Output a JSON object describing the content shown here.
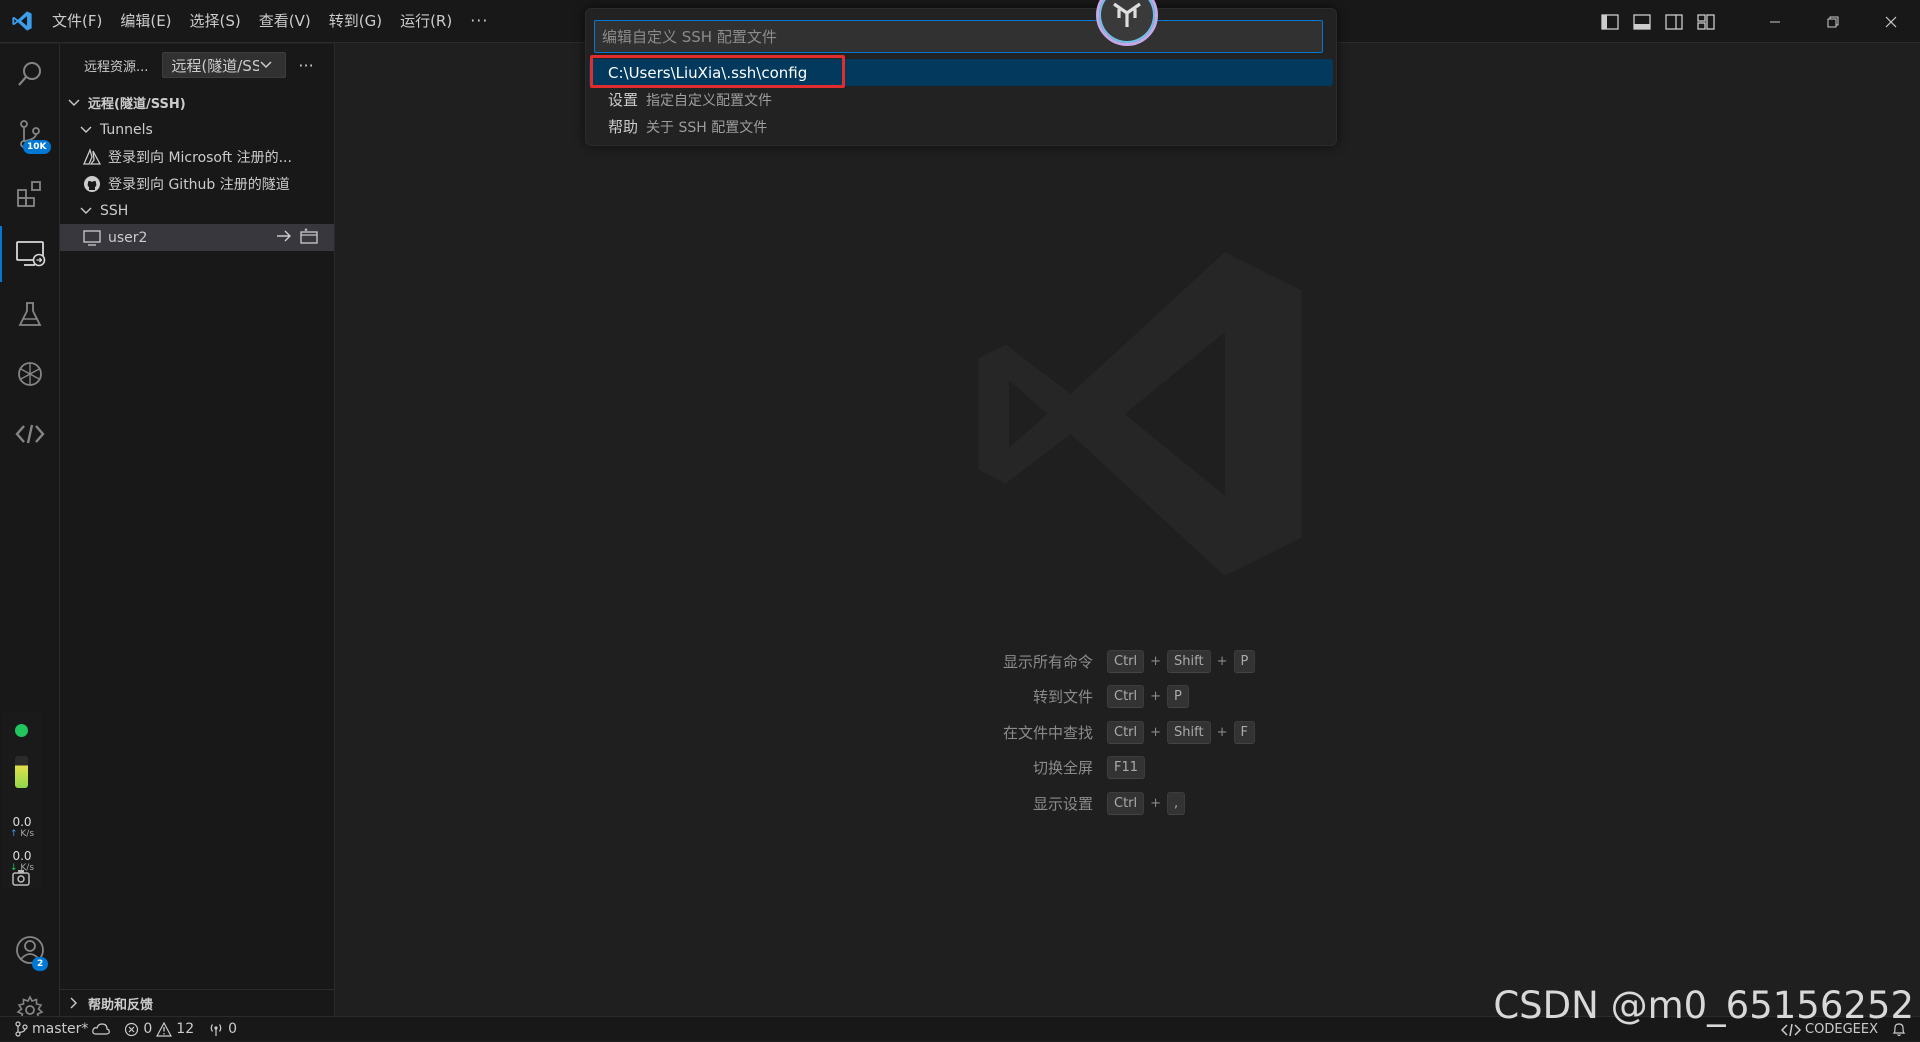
{
  "menu": [
    "文件(F)",
    "编辑(E)",
    "选择(S)",
    "查看(V)",
    "转到(G)",
    "运行(R)",
    "···"
  ],
  "sidebar": {
    "title": "远程资源...",
    "select_value": "远程(隧道/SSH)",
    "section_title": "远程(隧道/SSH)",
    "tunnels_label": "Tunnels",
    "tunnel_items": [
      "登录到向 Microsoft 注册的...",
      "登录到向 Github 注册的隧道"
    ],
    "ssh_label": "SSH",
    "ssh_host": "user2",
    "footer": "帮助和反馈"
  },
  "activity": {
    "scm_badge": "10K",
    "accounts_badge": "2"
  },
  "network": {
    "up_value": "0.0",
    "up_unit": "K/s",
    "down_value": "0.0",
    "down_unit": "K/s"
  },
  "quickpick": {
    "placeholder": "编辑自定义 SSH 配置文件",
    "items": [
      {
        "label": "C:\\Users\\LiuXia\\.ssh\\config",
        "desc": ""
      },
      {
        "label": "设置",
        "desc": "指定自定义配置文件"
      },
      {
        "label": "帮助",
        "desc": "关于 SSH 配置文件"
      }
    ]
  },
  "shortcuts": [
    {
      "label": "显示所有命令",
      "keys": [
        "Ctrl",
        "Shift",
        "P"
      ]
    },
    {
      "label": "转到文件",
      "keys": [
        "Ctrl",
        "P"
      ]
    },
    {
      "label": "在文件中查找",
      "keys": [
        "Ctrl",
        "Shift",
        "F"
      ]
    },
    {
      "label": "切换全屏",
      "keys": [
        "F11"
      ]
    },
    {
      "label": "显示设置",
      "keys": [
        "Ctrl",
        ","
      ]
    }
  ],
  "statusbar": {
    "branch": "master*",
    "errors": "0",
    "warnings": "12",
    "ports": "0",
    "codegeex": "CODEGEEX"
  },
  "watermark": "CSDN @m0_65156252",
  "colors": {
    "accent": "#0078d4",
    "highlight_box": "#e12d2d",
    "selected_item": "#04395e",
    "online_dot": "#22c55e"
  }
}
